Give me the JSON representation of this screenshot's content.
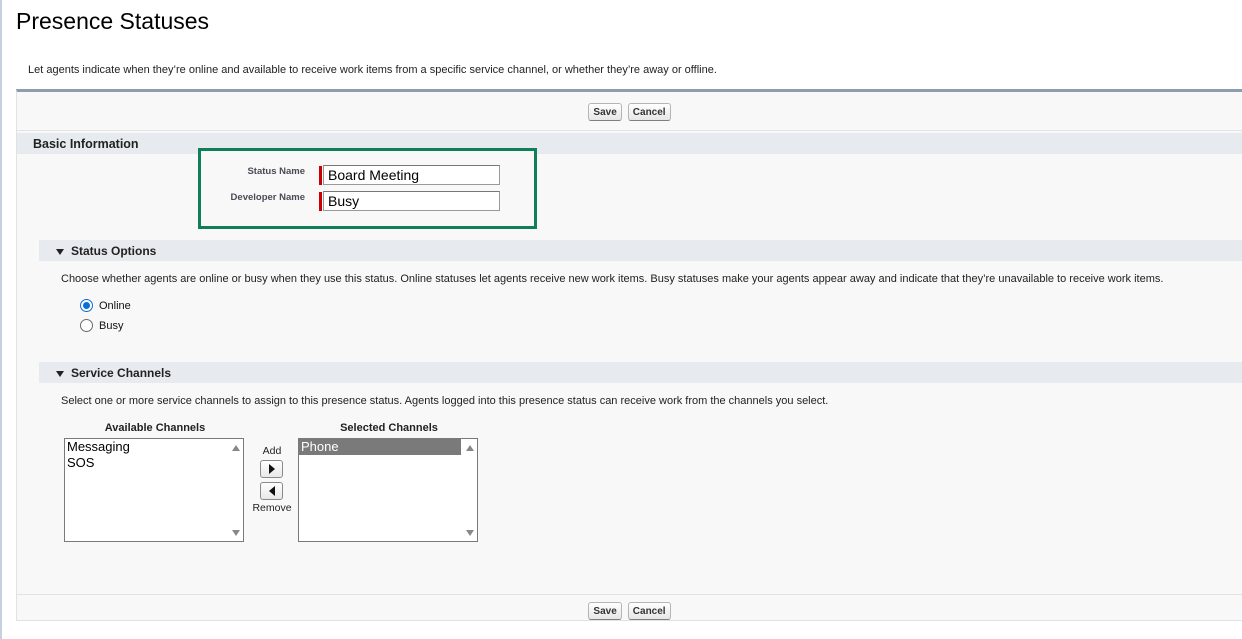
{
  "page": {
    "title": "Presence Statuses",
    "description": "Let agents indicate when they’re online and available to receive work items from a specific service channel, or whether they’re away or offline."
  },
  "buttons": {
    "save_label": "Save",
    "cancel_label": "Cancel"
  },
  "basic_info": {
    "header": "Basic Information",
    "status_name_label": "Status Name",
    "status_name_value": "Board Meeting",
    "developer_name_label": "Developer Name",
    "developer_name_value": "Busy",
    "highlight_color": "#0f7f58",
    "required_color": "#cc0000"
  },
  "status_options": {
    "header": "Status Options",
    "description": "Choose whether agents are online or busy when they use this status. Online statuses let agents receive new work items. Busy statuses make your agents appear away and indicate that they’re unavailable to receive work items.",
    "options": [
      {
        "label": "Online",
        "selected": true
      },
      {
        "label": "Busy",
        "selected": false
      }
    ]
  },
  "service_channels": {
    "header": "Service Channels",
    "description": "Select one or more service channels to assign to this presence status. Agents logged into this presence status can receive work from the channels you select.",
    "available_label": "Available Channels",
    "available": [
      "Messaging",
      "SOS"
    ],
    "selected_label": "Selected Channels",
    "selected": [
      "Phone"
    ],
    "add_label": "Add",
    "remove_label": "Remove"
  }
}
